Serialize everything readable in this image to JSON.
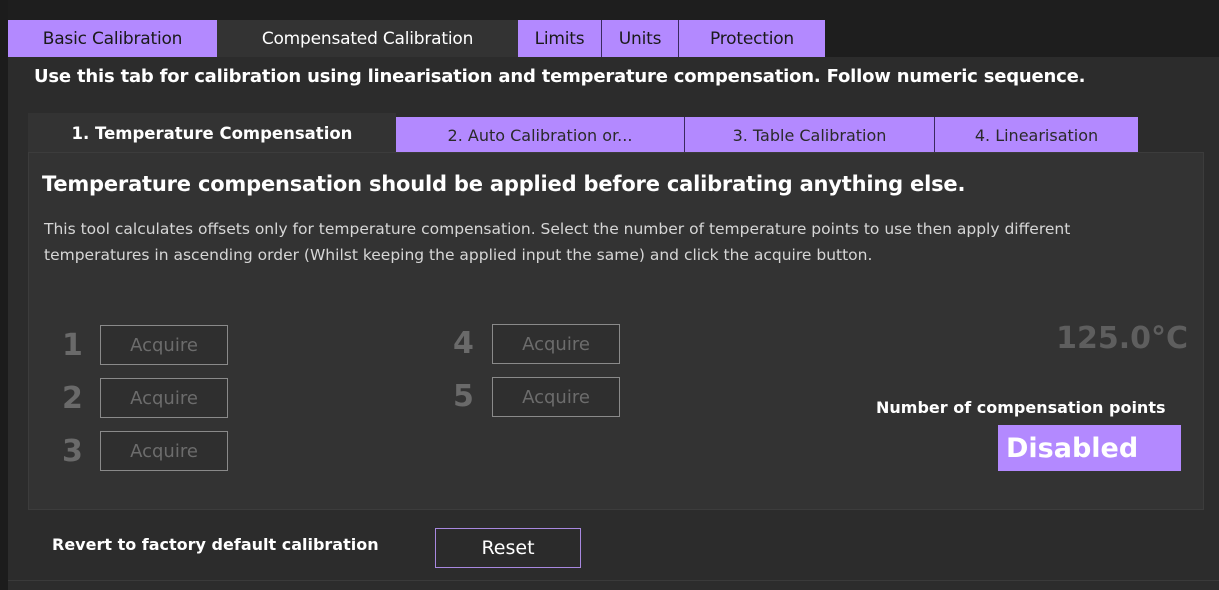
{
  "main_tabs": [
    {
      "label": "Basic Calibration",
      "active": false
    },
    {
      "label": "Compensated Calibration",
      "active": true
    },
    {
      "label": "Limits",
      "active": false
    },
    {
      "label": "Units",
      "active": false
    },
    {
      "label": "Protection",
      "active": false
    }
  ],
  "instructions": "Use this tab for calibration using linearisation and temperature compensation. Follow numeric sequence.",
  "sub_tabs": [
    {
      "label": "1. Temperature Compensation",
      "active": true
    },
    {
      "label": "2. Auto Calibration or...",
      "active": false
    },
    {
      "label": "3. Table Calibration",
      "active": false
    },
    {
      "label": "4. Linearisation",
      "active": false
    }
  ],
  "panel": {
    "heading": "Temperature compensation should be applied before calibrating anything else.",
    "description": "This tool calculates offsets only for temperature compensation. Select the number of temperature points to use  then apply different temperatures in ascending order (Whilst keeping the applied input the same) and click the acquire button.",
    "points": [
      {
        "number": "1",
        "button": "Acquire"
      },
      {
        "number": "2",
        "button": "Acquire"
      },
      {
        "number": "3",
        "button": "Acquire"
      },
      {
        "number": "4",
        "button": "Acquire"
      },
      {
        "number": "5",
        "button": "Acquire"
      }
    ],
    "temperature": "125.0°C",
    "compensation_points_label": "Number of compensation points",
    "compensation_points_value": "Disabled"
  },
  "footer": {
    "revert_label": "Revert to factory default calibration",
    "reset_button": "Reset"
  },
  "colors": {
    "accent": "#b389ff",
    "panel_bg": "#333333",
    "window_bg": "#2c2c2c"
  }
}
